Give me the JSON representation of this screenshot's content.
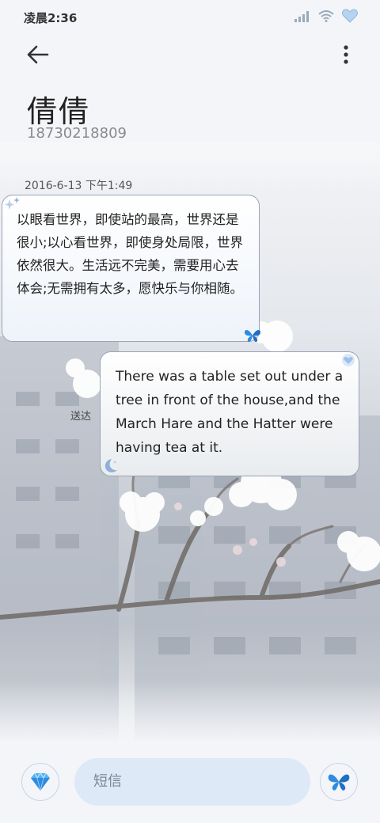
{
  "status_bar": {
    "time": "凌晨2:36",
    "icons": [
      "signal-icon",
      "wifi-icon",
      "battery-heart-icon"
    ]
  },
  "header": {
    "contact_name": "倩倩",
    "phone_number": "18730218809"
  },
  "thread": {
    "date": "2016-6-13 下午1:49",
    "messages": [
      {
        "direction": "incoming",
        "text": "以眼看世界，即使站的最高，世界还是很小;以心看世界，即使身处局限，世界依然很大。生活远不完美，需要用心去体会;无需拥有太多，愿快乐与你相随。"
      },
      {
        "direction": "outgoing",
        "text": "There was a table set out under a tree in front of the house,and the March Hare and the Hatter were having tea at it.",
        "status": "送达"
      }
    ]
  },
  "compose": {
    "placeholder": "短信"
  },
  "colors": {
    "accent_blue": "#2f8be0",
    "input_bg": "#dde9f7",
    "bubble_border": "#9aa3b5"
  }
}
